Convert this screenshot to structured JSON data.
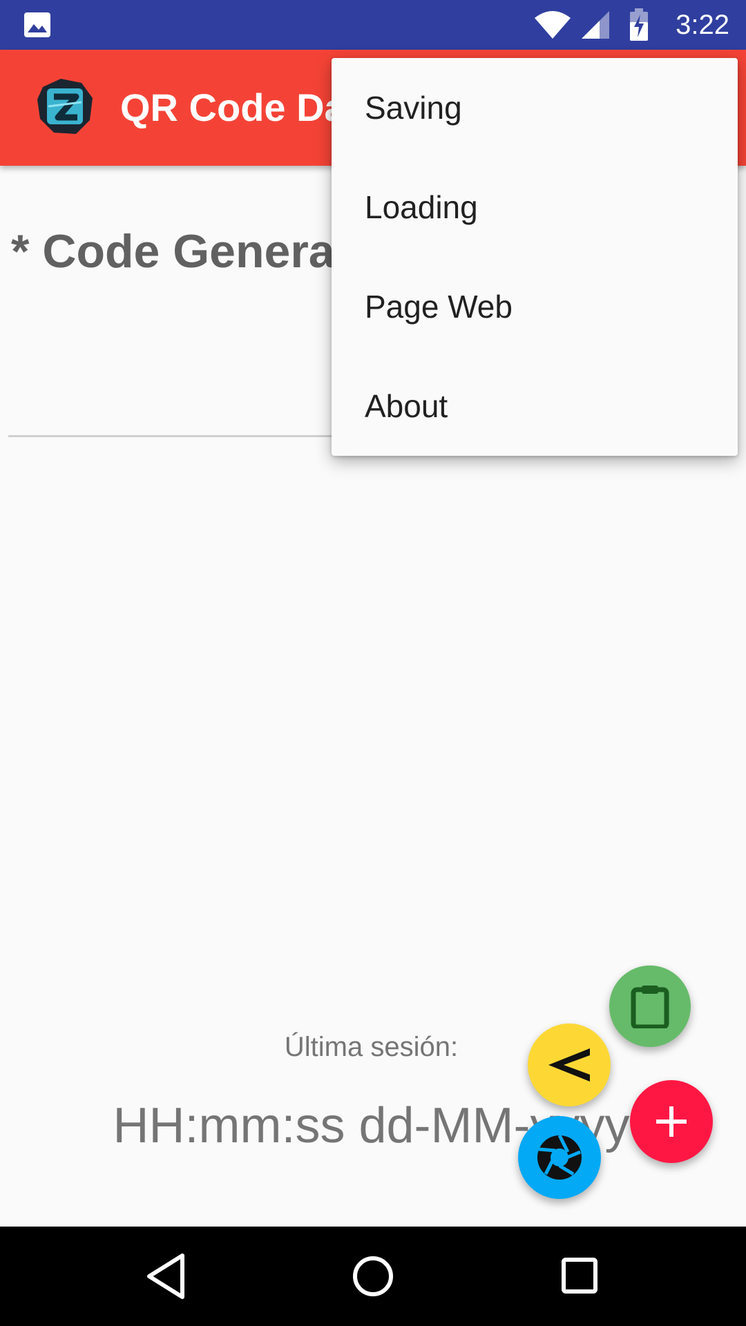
{
  "status_bar": {
    "time": "3:22",
    "icons": [
      "gallery-icon",
      "wifi-icon",
      "signal-icon",
      "battery-charging-icon"
    ]
  },
  "app_bar": {
    "title": "QR Code Da",
    "logo": "app-logo-z-icon",
    "color": "#f44336"
  },
  "content": {
    "heading": "* Code Genera",
    "last_session_label": "Última sesión:",
    "last_session_value": "HH:mm:ss dd-MM-yyyy"
  },
  "overflow_menu": {
    "items": [
      {
        "label": "Saving"
      },
      {
        "label": "Loading"
      },
      {
        "label": "Page Web"
      },
      {
        "label": "About"
      }
    ]
  },
  "fabs": [
    {
      "name": "clipboard-icon",
      "color": "#66bb6a"
    },
    {
      "name": "share-icon",
      "color": "#fdd835"
    },
    {
      "name": "add-icon",
      "color": "#ff1744"
    },
    {
      "name": "camera-aperture-icon",
      "color": "#03a9f4"
    }
  ],
  "nav_bar": {
    "icons": [
      "back-icon",
      "home-icon",
      "recents-icon"
    ]
  }
}
